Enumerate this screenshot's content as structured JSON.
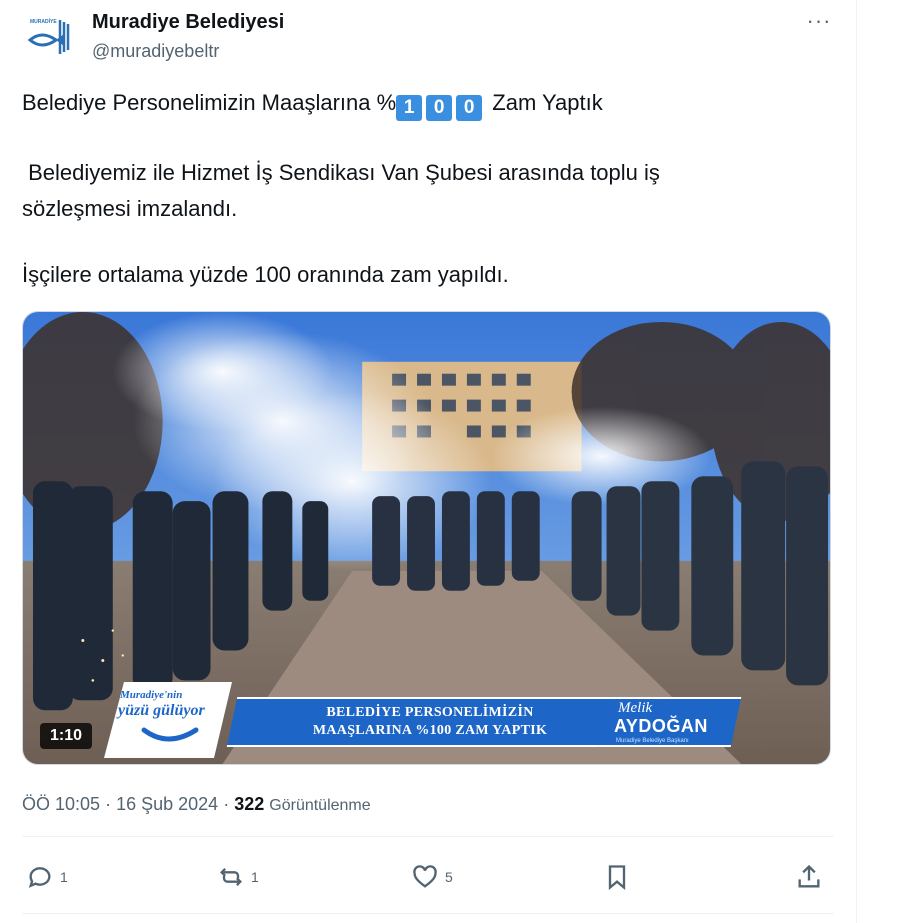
{
  "account": {
    "name": "Muradiye Belediyesi",
    "handle": "@muradiyebeltr"
  },
  "post": {
    "line1_text": "Belediye Personelimizin Maaşlarına %",
    "line1_keycaps": [
      "1",
      "0",
      "0"
    ],
    "line1_end": "Zam Yaptık",
    "line2": " Belediyemiz ile Hizmet İş Sendikası Van Şubesi arasında toplu iş",
    "line3": "sözleşmesi imzalandı.",
    "line4": "İşçilere ortalama yüzde 100 oranında zam yapıldı."
  },
  "video": {
    "duration": "1:10",
    "banner_left_small": "Muradiye'nin",
    "banner_left_big": "yüzü gülüyor",
    "banner_line1": "BELEDİYE PERSONELİMİZİN",
    "banner_line2": "MAAŞLARINA %100 ZAM YAPTIK",
    "signature_script": "Melik",
    "signature_name": "AYDOĞAN",
    "signature_sub": "Muradiye Belediye Başkanı"
  },
  "meta": {
    "time": "ÖÖ 10:05",
    "date": "16 Şub 2024",
    "views": "322",
    "views_label": "Görüntülenme",
    "separator": "·"
  },
  "actions": {
    "replies": "1",
    "reposts": "1",
    "likes": "5"
  },
  "colors": {
    "text": "#0f1419",
    "secondary": "#536471",
    "banner_blue": "#1d66c7",
    "keycap_blue": "#3b8fe0"
  },
  "icons": [
    "more-icon",
    "reply-icon",
    "repost-icon",
    "like-icon",
    "bookmark-icon",
    "share-icon"
  ]
}
